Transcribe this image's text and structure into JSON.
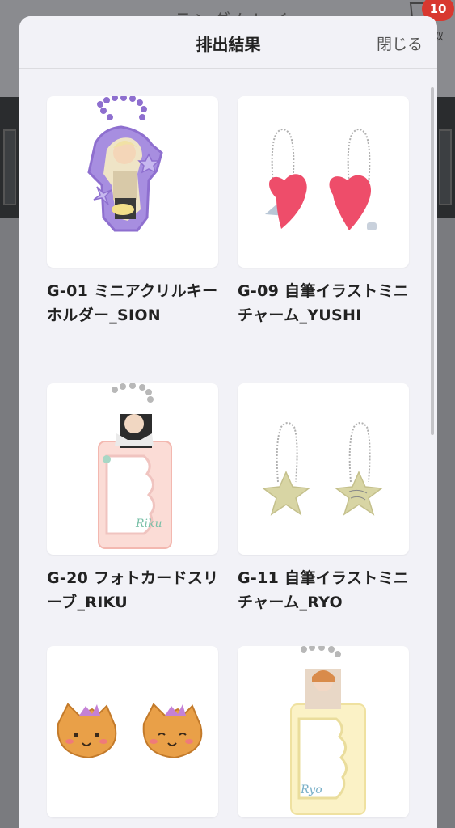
{
  "background": {
    "title": "ランダムレイ",
    "badge_count": "10",
    "side_char": "双"
  },
  "modal": {
    "title": "排出結果",
    "close_label": "閉じる"
  },
  "items": [
    {
      "name": "G-01 ミニアクリルキーホルダー_SION"
    },
    {
      "name": "G-09 自筆イラストミニチャーム_YUSHI"
    },
    {
      "name": "G-20 フォトカードスリーブ_RIKU"
    },
    {
      "name": "G-11 自筆イラストミニチャーム_RYO"
    },
    {
      "name": ""
    },
    {
      "name": ""
    }
  ],
  "colors": {
    "accent_badge": "#d8382f",
    "sheet_bg": "#f2f2f7"
  }
}
